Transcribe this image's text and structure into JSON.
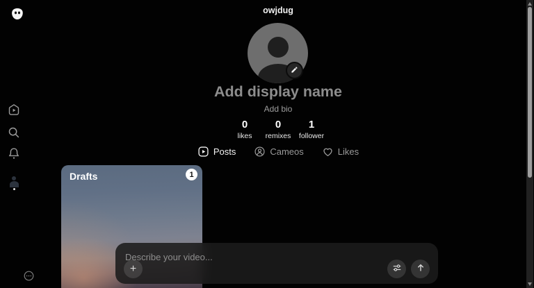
{
  "header": {
    "username": "owjdug"
  },
  "sidebar": {
    "logo_icon": "sora-logo",
    "items": [
      {
        "id": "home",
        "icon": "home-feed-icon"
      },
      {
        "id": "search",
        "icon": "search-icon"
      },
      {
        "id": "notifications",
        "icon": "bell-icon"
      },
      {
        "id": "profile",
        "icon": "profile-avatar-icon",
        "active": true
      }
    ],
    "footer_icon": "help-ellipsis-icon"
  },
  "profile": {
    "display_name_placeholder": "Add display name",
    "bio_placeholder": "Add bio",
    "edit_avatar_icon": "pencil-icon",
    "stats": [
      {
        "value": "0",
        "label": "likes"
      },
      {
        "value": "0",
        "label": "remixes"
      },
      {
        "value": "1",
        "label": "follower"
      }
    ],
    "tabs": [
      {
        "label": "Posts",
        "icon": "posts-icon",
        "active": true
      },
      {
        "label": "Cameos",
        "icon": "cameos-icon",
        "active": false
      },
      {
        "label": "Likes",
        "icon": "likes-heart-icon",
        "active": false
      }
    ]
  },
  "content": {
    "drafts_card": {
      "title": "Drafts",
      "badge_count": "1"
    }
  },
  "composer": {
    "placeholder": "Describe your video...",
    "add_icon": "+",
    "settings_icon": "sliders-icon",
    "submit_icon": "arrow-up-icon"
  },
  "colors": {
    "background": "#000000",
    "card_top": "#5d6d82",
    "card_warm_glow": "#a3806f",
    "card_bottom": "#443a46",
    "composer_bg": "#1b1b1b",
    "primary_text": "#ffffff",
    "muted_text": "#8e8e8e",
    "avatar_gray": "#6e6e6e"
  }
}
